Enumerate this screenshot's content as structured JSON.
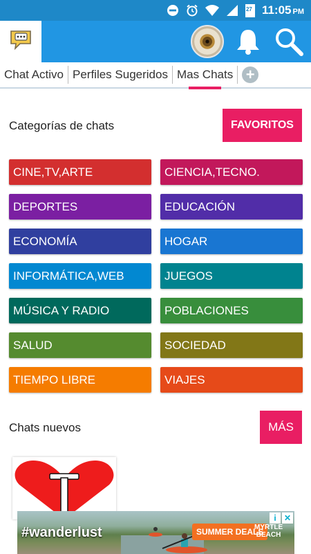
{
  "status_bar": {
    "time": "11:05",
    "ampm": "PM",
    "calendar_day": "27"
  },
  "tabs": [
    {
      "label": "Chat Activo"
    },
    {
      "label": "Perfiles Sugeridos"
    },
    {
      "label": "Mas Chats",
      "active": true
    }
  ],
  "categories_section": {
    "title": "Categorías de chats",
    "favorites_label": "FAVORITOS"
  },
  "categories": [
    {
      "label": "CINE,TV,ARTE",
      "color": "#d32f2f"
    },
    {
      "label": "CIENCIA,TECNO.",
      "color": "#c2185b"
    },
    {
      "label": "DEPORTES",
      "color": "#7b1fa2"
    },
    {
      "label": "EDUCACIÓN",
      "color": "#512da8"
    },
    {
      "label": "ECONOMÍA",
      "color": "#303f9f"
    },
    {
      "label": "HOGAR",
      "color": "#1976d2"
    },
    {
      "label": "INFORMÁTICA,WEB",
      "color": "#0288d1"
    },
    {
      "label": "JUEGOS",
      "color": "#00838f"
    },
    {
      "label": "MÚSICA Y RADIO",
      "color": "#00695c"
    },
    {
      "label": "POBLACIONES",
      "color": "#388e3c"
    },
    {
      "label": "SALUD",
      "color": "#558b2f"
    },
    {
      "label": "SOCIEDAD",
      "color": "#827717"
    },
    {
      "label": "TIEMPO LIBRE",
      "color": "#f57c00"
    },
    {
      "label": "VIAJES",
      "color": "#e64a19"
    }
  ],
  "new_chats": {
    "title": "Chats nuevos",
    "more_label": "MÁS"
  },
  "ad": {
    "tagline": "#wanderlust",
    "deal": "SUMMER DEALS",
    "destination_line1": "MYRTLE",
    "destination_line2": "BEACH"
  },
  "colors": {
    "primary": "#2196e3",
    "status_bar": "#1e88c8",
    "accent": "#e91e63"
  }
}
